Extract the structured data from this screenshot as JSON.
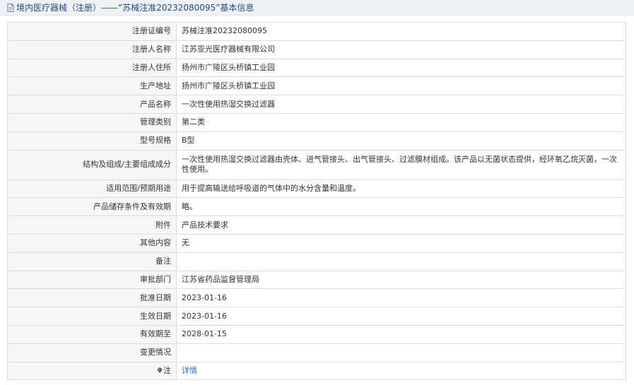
{
  "header": {
    "title": "境内医疗器械（注册）——“苏械注准20232080095”基本信息"
  },
  "rows": [
    {
      "label": "注册证编号",
      "value": "苏械注准20232080095"
    },
    {
      "label": "注册人名称",
      "value": "江苏亚光医疗器械有限公司"
    },
    {
      "label": "注册人住所",
      "value": "扬州市广陵区头桥镇工业园"
    },
    {
      "label": "生产地址",
      "value": "扬州市广陵区头桥镇工业园"
    },
    {
      "label": "产品名称",
      "value": "一次性使用热湿交换过滤器"
    },
    {
      "label": "管理类别",
      "value": "第二类"
    },
    {
      "label": "型号规格",
      "value": "B型"
    },
    {
      "label": "结构及组成/主要组成成分",
      "value": "一次性使用热湿交换过滤器由壳体、进气管接头、出气管接头、过滤膜材组成。该产品以无菌状态提供，经环氧乙烷灭菌，一次性使用。"
    },
    {
      "label": "适用范围/预期用途",
      "value": "用于提高输送给呼吸道的气体中的水分含量和温度。"
    },
    {
      "label": "产品储存条件及有效期",
      "value": "略。"
    },
    {
      "label": "附件",
      "value": "产品技术要求"
    },
    {
      "label": "其他内容",
      "value": "无"
    },
    {
      "label": "备注",
      "value": ""
    },
    {
      "label": "审批部门",
      "value": "江苏省药品监督管理局"
    },
    {
      "label": "批准日期",
      "value": "2023-01-16"
    },
    {
      "label": "生效日期",
      "value": "2023-01-16"
    },
    {
      "label": "有效期至",
      "value": "2028-01-15"
    },
    {
      "label": "变更情况",
      "value": ""
    },
    {
      "label": "注",
      "value": "详情"
    }
  ],
  "icons": {
    "title_icon": "document-icon",
    "note_icon": "pin-icon"
  },
  "colors": {
    "link": "#2b71c4",
    "title": "#2a4a7a"
  }
}
